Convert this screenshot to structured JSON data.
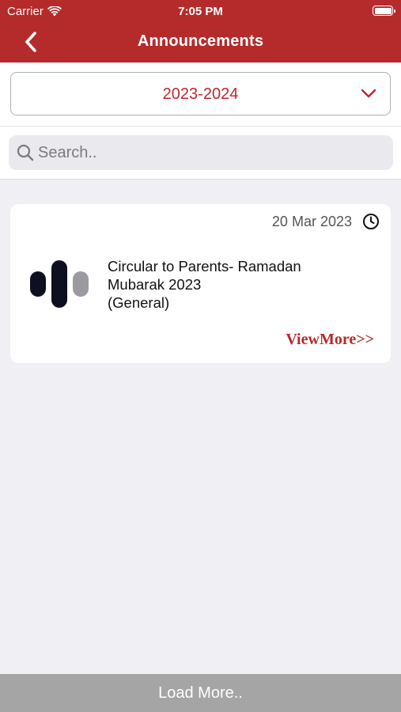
{
  "status_bar": {
    "carrier": "Carrier",
    "time": "7:05 PM"
  },
  "nav": {
    "title": "Announcements"
  },
  "year_select": {
    "value": "2023-2024"
  },
  "search": {
    "placeholder": "Search.."
  },
  "announcements": [
    {
      "date": "20 Mar 2023",
      "title": "Circular to Parents- Ramadan Mubarak 2023",
      "category": "(General)",
      "view_more": "ViewMore>>"
    }
  ],
  "footer": {
    "load_more": "Load More.."
  },
  "colors": {
    "brand": "#b52b2b",
    "accent_text": "#c0272d",
    "background": "#efeff4",
    "load_more_bar": "#a5a5a5"
  },
  "icons": {
    "wifi": "wifi-icon",
    "battery": "battery-icon",
    "back": "chevron-left-icon",
    "dropdown": "chevron-down-icon",
    "search": "search-icon",
    "clock": "clock-icon",
    "logo": "school-logo-icon"
  }
}
